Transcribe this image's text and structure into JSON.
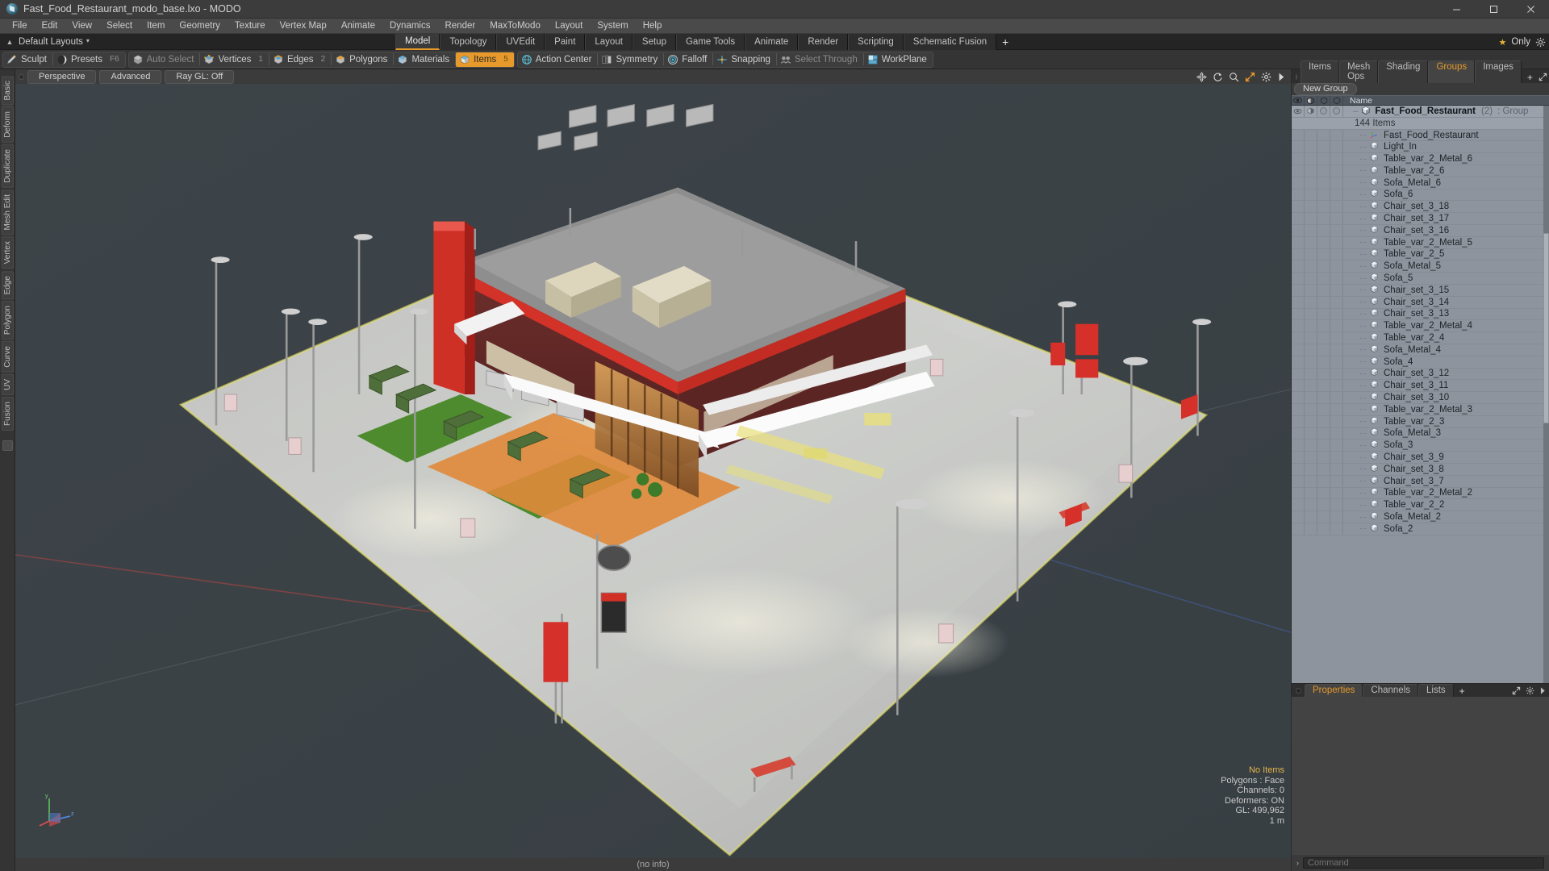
{
  "window": {
    "title": "Fast_Food_Restaurant_modo_base.lxo - MODO",
    "app_icon": "modo-logo-icon",
    "minimize": "minimize-button",
    "maximize": "maximize-button",
    "close": "close-button"
  },
  "menubar": {
    "items": [
      {
        "label": "File"
      },
      {
        "label": "Edit"
      },
      {
        "label": "View"
      },
      {
        "label": "Select"
      },
      {
        "label": "Item"
      },
      {
        "label": "Geometry"
      },
      {
        "label": "Texture"
      },
      {
        "label": "Vertex Map"
      },
      {
        "label": "Animate"
      },
      {
        "label": "Dynamics"
      },
      {
        "label": "Render"
      },
      {
        "label": "MaxToModo"
      },
      {
        "label": "Layout"
      },
      {
        "label": "System"
      },
      {
        "label": "Help"
      }
    ]
  },
  "layoutbar": {
    "preset_label": "Default Layouts",
    "caret": "▾",
    "tabs": [
      {
        "label": "Model",
        "active": true
      },
      {
        "label": "Topology",
        "active": false
      },
      {
        "label": "UVEdit",
        "active": false
      },
      {
        "label": "Paint",
        "active": false
      },
      {
        "label": "Layout",
        "active": false
      },
      {
        "label": "Setup",
        "active": false
      },
      {
        "label": "Game Tools",
        "active": false
      },
      {
        "label": "Animate",
        "active": false
      },
      {
        "label": "Render",
        "active": false
      },
      {
        "label": "Scripting",
        "active": false
      },
      {
        "label": "Schematic Fusion",
        "active": false
      }
    ],
    "add_tab": "+",
    "only_label": "Only",
    "star_icon": "star-icon",
    "config_icon": "gear-icon"
  },
  "toolbar": {
    "group1": [
      {
        "label": "Sculpt",
        "icon": "sculpt-brush-icon",
        "shortcut": "",
        "state": "normal"
      },
      {
        "label": "Presets",
        "icon": "presets-sphere-icon",
        "shortcut": "F6",
        "state": "normal"
      }
    ],
    "group2": [
      {
        "label": "Auto Select",
        "icon": "auto-select-icon",
        "shortcut": "",
        "state": "dim"
      },
      {
        "label": "Vertices",
        "icon": "vertices-icon",
        "shortcut": "1",
        "state": "normal"
      },
      {
        "label": "Edges",
        "icon": "edges-icon",
        "shortcut": "2",
        "state": "normal"
      },
      {
        "label": "Polygons",
        "icon": "polygons-icon",
        "shortcut": "",
        "state": "normal"
      },
      {
        "label": "Materials",
        "icon": "materials-icon",
        "shortcut": "",
        "state": "normal"
      },
      {
        "label": "Items",
        "icon": "items-icon",
        "shortcut": "5",
        "state": "selected"
      }
    ],
    "group3": [
      {
        "label": "Action Center",
        "icon": "action-center-icon",
        "shortcut": "",
        "state": "normal"
      },
      {
        "label": "Symmetry",
        "icon": "symmetry-icon",
        "shortcut": "",
        "state": "normal"
      },
      {
        "label": "Falloff",
        "icon": "falloff-icon",
        "shortcut": "",
        "state": "normal"
      },
      {
        "label": "Snapping",
        "icon": "snapping-icon",
        "shortcut": "",
        "state": "normal"
      },
      {
        "label": "Select Through",
        "icon": "select-through-icon",
        "shortcut": "",
        "state": "dim"
      },
      {
        "label": "WorkPlane",
        "icon": "workplane-icon",
        "shortcut": "",
        "state": "normal"
      }
    ]
  },
  "left_strip": {
    "tabs": [
      {
        "label": "Basic"
      },
      {
        "label": "Deform"
      },
      {
        "label": "Duplicate"
      },
      {
        "label": "Mesh Edit"
      },
      {
        "label": "Vertex"
      },
      {
        "label": "Edge"
      },
      {
        "label": "Polygon"
      },
      {
        "label": "Curve"
      },
      {
        "label": "UV"
      },
      {
        "label": "Fusion"
      }
    ]
  },
  "viewport": {
    "header_buttons": [
      {
        "label": "Perspective"
      },
      {
        "label": "Advanced"
      },
      {
        "label": "Ray GL: Off"
      }
    ],
    "header_icons": [
      "move-icon",
      "rotate-icon",
      "zoom-search-icon",
      "fit-expand-icon",
      "gear-icon",
      "play-arrow-icon"
    ],
    "stats": {
      "selection": "No Items",
      "polygons": "Polygons : Face",
      "channels": "Channels: 0",
      "deformers": "Deformers: ON",
      "gl": "GL: 499,962",
      "grid": "1 m"
    },
    "axis_gizmo": "axis-gizmo-icon",
    "footer_info": "(no info)"
  },
  "right_panel": {
    "tabs": [
      {
        "label": "Items",
        "active": false
      },
      {
        "label": "Mesh Ops",
        "active": false
      },
      {
        "label": "Shading",
        "active": false
      },
      {
        "label": "Groups",
        "active": true
      },
      {
        "label": "Images",
        "active": false
      }
    ],
    "add_tab": "+",
    "new_group_button": "New Group",
    "columns": [
      {
        "icon": "eye-icon"
      },
      {
        "icon": "render-visibility-icon"
      },
      {
        "icon": "lock-shape-icon"
      },
      {
        "icon": "select-shape-icon"
      },
      {
        "label": "Name"
      }
    ],
    "group": {
      "name": "Fast_Food_Restaurant",
      "count": "(2)",
      "type": ": Group",
      "subtitle": "144 Items",
      "icon": "group-cube-icon"
    },
    "items": [
      {
        "name": "Fast_Food_Restaurant",
        "icon": "locator-axis-icon"
      },
      {
        "name": "Light_In",
        "icon": "mesh-cube-icon"
      },
      {
        "name": "Table_var_2_Metal_6",
        "icon": "mesh-cube-icon"
      },
      {
        "name": "Table_var_2_6",
        "icon": "mesh-cube-icon"
      },
      {
        "name": "Sofa_Metal_6",
        "icon": "mesh-cube-icon"
      },
      {
        "name": "Sofa_6",
        "icon": "mesh-cube-icon"
      },
      {
        "name": "Chair_set_3_18",
        "icon": "mesh-cube-icon"
      },
      {
        "name": "Chair_set_3_17",
        "icon": "mesh-cube-icon"
      },
      {
        "name": "Chair_set_3_16",
        "icon": "mesh-cube-icon"
      },
      {
        "name": "Table_var_2_Metal_5",
        "icon": "mesh-cube-icon"
      },
      {
        "name": "Table_var_2_5",
        "icon": "mesh-cube-icon"
      },
      {
        "name": "Sofa_Metal_5",
        "icon": "mesh-cube-icon"
      },
      {
        "name": "Sofa_5",
        "icon": "mesh-cube-icon"
      },
      {
        "name": "Chair_set_3_15",
        "icon": "mesh-cube-icon"
      },
      {
        "name": "Chair_set_3_14",
        "icon": "mesh-cube-icon"
      },
      {
        "name": "Chair_set_3_13",
        "icon": "mesh-cube-icon"
      },
      {
        "name": "Table_var_2_Metal_4",
        "icon": "mesh-cube-icon"
      },
      {
        "name": "Table_var_2_4",
        "icon": "mesh-cube-icon"
      },
      {
        "name": "Sofa_Metal_4",
        "icon": "mesh-cube-icon"
      },
      {
        "name": "Sofa_4",
        "icon": "mesh-cube-icon"
      },
      {
        "name": "Chair_set_3_12",
        "icon": "mesh-cube-icon"
      },
      {
        "name": "Chair_set_3_11",
        "icon": "mesh-cube-icon"
      },
      {
        "name": "Chair_set_3_10",
        "icon": "mesh-cube-icon"
      },
      {
        "name": "Table_var_2_Metal_3",
        "icon": "mesh-cube-icon"
      },
      {
        "name": "Table_var_2_3",
        "icon": "mesh-cube-icon"
      },
      {
        "name": "Sofa_Metal_3",
        "icon": "mesh-cube-icon"
      },
      {
        "name": "Sofa_3",
        "icon": "mesh-cube-icon"
      },
      {
        "name": "Chair_set_3_9",
        "icon": "mesh-cube-icon"
      },
      {
        "name": "Chair_set_3_8",
        "icon": "mesh-cube-icon"
      },
      {
        "name": "Chair_set_3_7",
        "icon": "mesh-cube-icon"
      },
      {
        "name": "Table_var_2_Metal_2",
        "icon": "mesh-cube-icon"
      },
      {
        "name": "Table_var_2_2",
        "icon": "mesh-cube-icon"
      },
      {
        "name": "Sofa_Metal_2",
        "icon": "mesh-cube-icon"
      },
      {
        "name": "Sofa_2",
        "icon": "mesh-cube-icon"
      }
    ],
    "bottom_tabs": [
      {
        "label": "Properties",
        "active": true
      },
      {
        "label": "Channels",
        "active": false
      },
      {
        "label": "Lists",
        "active": false
      }
    ],
    "bottom_add_tab": "+"
  },
  "command_bar": {
    "placeholder": "Command",
    "caret": "›"
  },
  "colors": {
    "accent": "#e79a2b",
    "panel": "#3a3a3a",
    "list_bg": "#8d949d",
    "viewport_bg": "#3b4246"
  }
}
